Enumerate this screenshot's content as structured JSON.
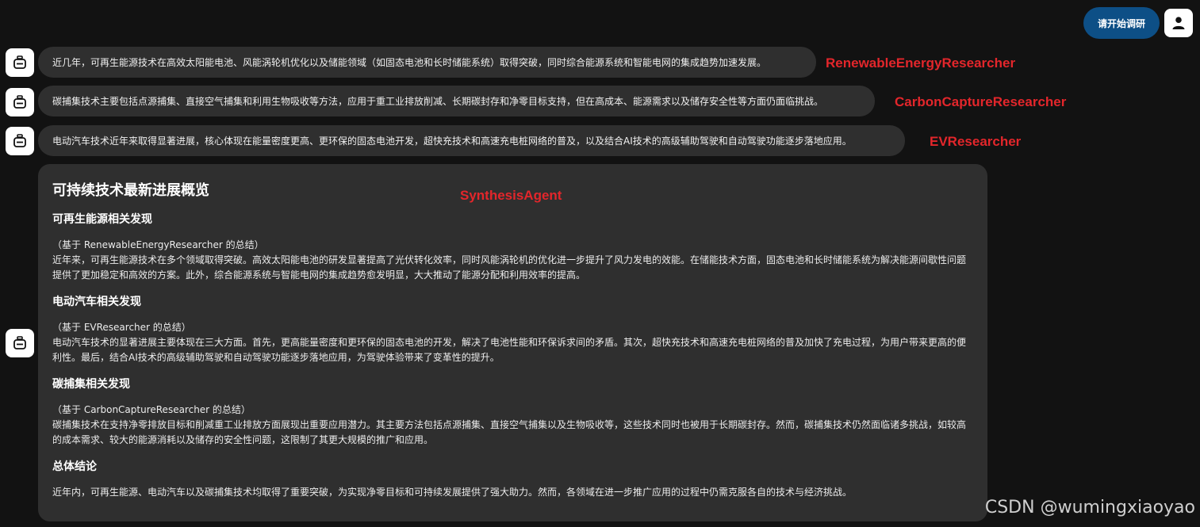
{
  "user": {
    "message": "请开始调研",
    "avatar_icon": "person-icon"
  },
  "bot_icon": "robot-icon",
  "agents": [
    {
      "tag": "RenewableEnergyResearcher",
      "message": "近几年，可再生能源技术在高效太阳能电池、风能涡轮机优化以及储能领域（如固态电池和长时储能系统）取得突破，同时综合能源系统和智能电网的集成趋势加速发展。"
    },
    {
      "tag": "CarbonCaptureResearcher",
      "message": "碳捕集技术主要包括点源捕集、直接空气捕集和利用生物吸收等方法，应用于重工业排放削减、长期碳封存和净零目标支持，但在高成本、能源需求以及储存安全性等方面仍面临挑战。"
    },
    {
      "tag": "EVResearcher",
      "message": "电动汽车技术近年来取得显著进展，核心体现在能量密度更高、更环保的固态电池开发，超快充技术和高速充电桩网络的普及，以及结合AI技术的高级辅助驾驶和自动驾驶功能逐步落地应用。"
    }
  ],
  "synthesis": {
    "tag": "SynthesisAgent",
    "title": "可持续技术最新进展概览",
    "sections": [
      {
        "heading": "可再生能源相关发现",
        "source": "（基于 RenewableEnergyResearcher 的总结）",
        "body": "近年来，可再生能源技术在多个领域取得突破。高效太阳能电池的研发显著提高了光伏转化效率，同时风能涡轮机的优化进一步提升了风力发电的效能。在储能技术方面，固态电池和长时储能系统为解决能源间歇性问题提供了更加稳定和高效的方案。此外，综合能源系统与智能电网的集成趋势愈发明显，大大推动了能源分配和利用效率的提高。"
      },
      {
        "heading": "电动汽车相关发现",
        "source": "（基于 EVResearcher 的总结）",
        "body": "电动汽车技术的显著进展主要体现在三大方面。首先，更高能量密度和更环保的固态电池的开发，解决了电池性能和环保诉求间的矛盾。其次，超快充技术和高速充电桩网络的普及加快了充电过程，为用户带来更高的便利性。最后，结合AI技术的高级辅助驾驶和自动驾驶功能逐步落地应用，为驾驶体验带来了变革性的提升。"
      },
      {
        "heading": "碳捕集相关发现",
        "source": "（基于 CarbonCaptureResearcher 的总结）",
        "body": "碳捕集技术在支持净零排放目标和削减重工业排放方面展现出重要应用潜力。其主要方法包括点源捕集、直接空气捕集以及生物吸收等，这些技术同时也被用于长期碳封存。然而，碳捕集技术仍然面临诸多挑战，如较高的成本需求、较大的能源消耗以及储存的安全性问题，这限制了其更大规模的推广和应用。"
      }
    ],
    "conclusion": {
      "heading": "总体结论",
      "body": "近年内，可再生能源、电动汽车以及碳捕集技术均取得了重要突破，为实现净零目标和可持续发展提供了强大助力。然而，各领域在进一步推广应用的过程中仍需克服各自的技术与经济挑战。"
    }
  },
  "watermark": "CSDN @wumingxiaoyao"
}
